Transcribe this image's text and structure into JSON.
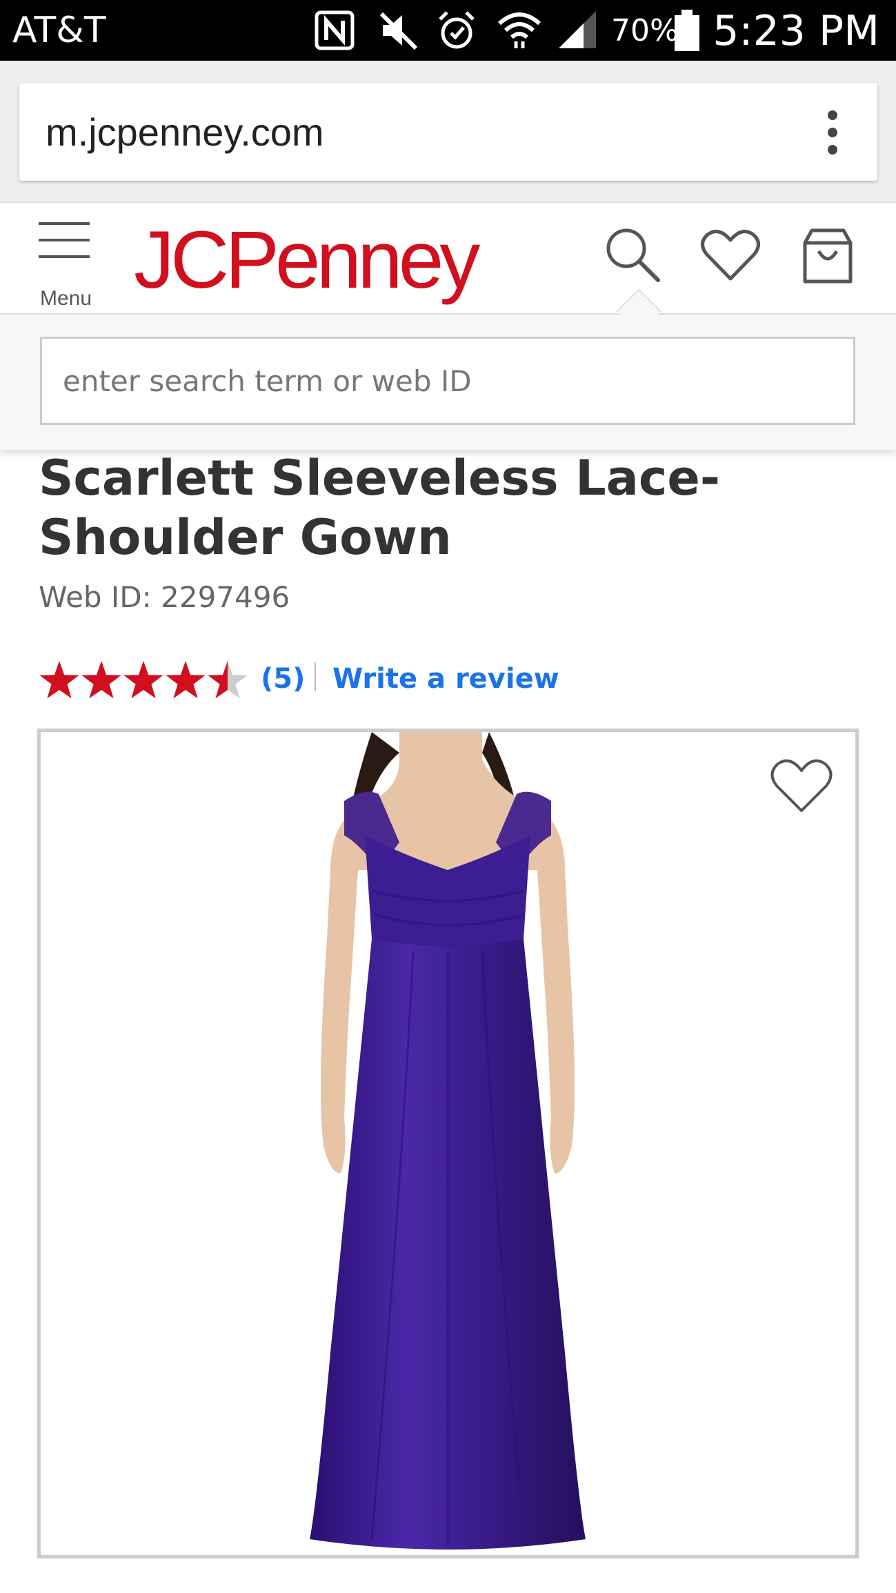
{
  "status_bar": {
    "carrier": "AT&T",
    "battery": "70%",
    "time": "5:23 PM",
    "icons": [
      "nfc-icon",
      "mute-icon",
      "alarm-icon",
      "wifi-icon",
      "signal-icon",
      "battery-icon"
    ]
  },
  "browser": {
    "url": "m.jcpenney.com",
    "menu_icon": "kebab-menu-icon"
  },
  "header": {
    "menu_label": "Menu",
    "logo_text": "JCPenney",
    "brand_color": "#d20f1e",
    "icons": [
      "search-icon",
      "heart-icon",
      "shopping-bag-icon"
    ]
  },
  "search": {
    "placeholder": "enter search term or web ID"
  },
  "product": {
    "title": "Scarlett Sleeveless Lace-Shoulder Gown",
    "web_id": "Web ID: 2297496",
    "rating": 4.5,
    "rating_max": 5,
    "review_count": "(5)",
    "write_review": "Write a review",
    "dress_color": "#3b1c8c"
  }
}
